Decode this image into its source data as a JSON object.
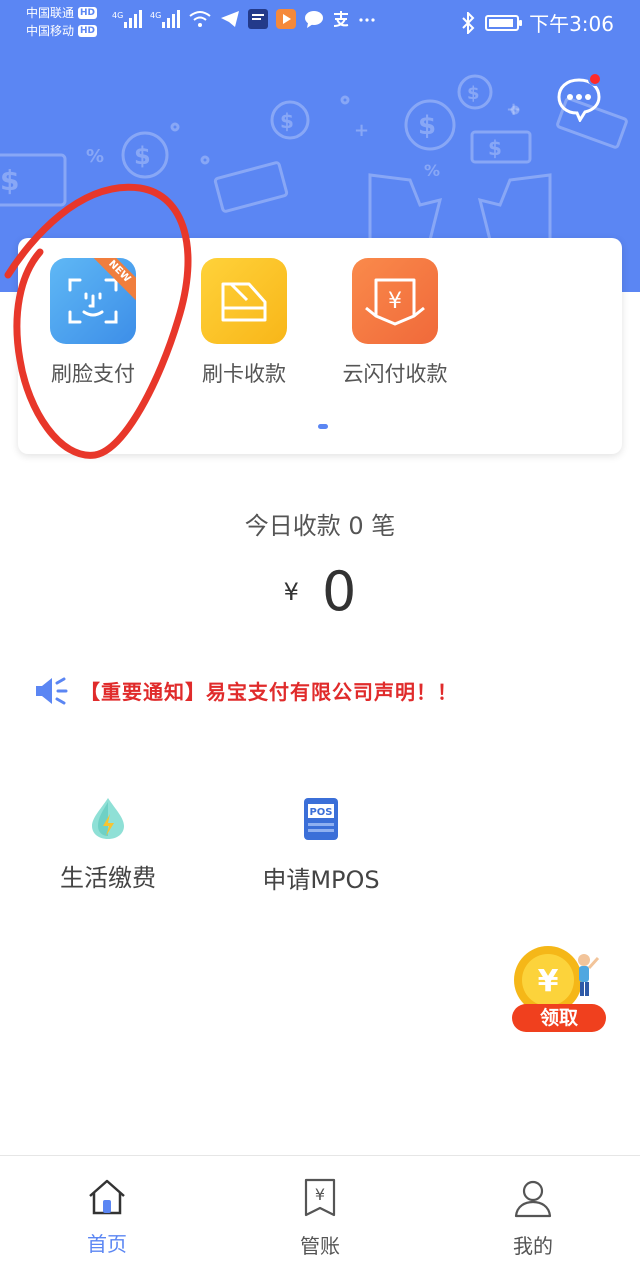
{
  "status": {
    "carrier1": "中国联通",
    "carrier2": "中国移动",
    "hd": "HD",
    "signal_label": "4G",
    "time": "下午3:06"
  },
  "apps": [
    {
      "label": "刷脸支付",
      "badge": "NEW",
      "icon": "face-scan-icon",
      "color": "#4da8f0"
    },
    {
      "label": "刷卡收款",
      "icon": "card-swipe-icon",
      "color": "#fbc21f"
    },
    {
      "label": "云闪付收款",
      "icon": "receipt-yen-icon",
      "color": "#f47a43"
    }
  ],
  "today": {
    "text": "今日收款 0 笔",
    "currency": "¥",
    "amount": "0"
  },
  "notice": {
    "text": "【重要通知】易宝支付有限公司声明！！",
    "icon": "speaker-icon"
  },
  "services": [
    {
      "label": "生活缴费",
      "icon": "water-drop-icon"
    },
    {
      "label": "申请MPOS",
      "icon": "pos-terminal-icon",
      "icon_text": "POS"
    }
  ],
  "reward": {
    "label": "领取",
    "symbol": "¥"
  },
  "nav": [
    {
      "label": "首页",
      "icon": "home-icon",
      "active": true
    },
    {
      "label": "管账",
      "icon": "ledger-icon",
      "active": false
    },
    {
      "label": "我的",
      "icon": "profile-icon",
      "active": false
    }
  ],
  "colors": {
    "primary": "#5b86f3",
    "notice_red": "#e02b2b",
    "annotation_red": "#e8372a"
  }
}
